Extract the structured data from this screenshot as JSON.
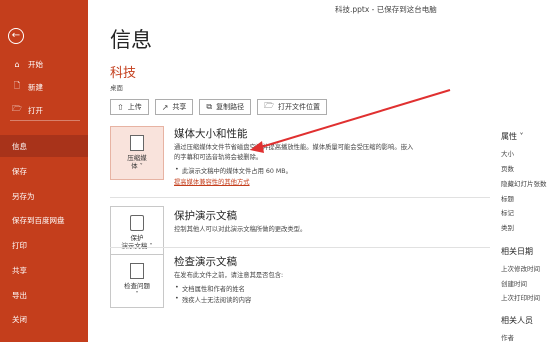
{
  "window": {
    "title": "科技.pptx - 已保存到这台电脑"
  },
  "sidebar": {
    "items": [
      {
        "label": "开始",
        "icon": "home-icon",
        "glyph": "⌂"
      },
      {
        "label": "新建",
        "icon": "new-file-icon",
        "glyph": "🗋"
      },
      {
        "label": "打开",
        "icon": "folder-open-icon",
        "glyph": "🗁"
      },
      {
        "label": "信息"
      },
      {
        "label": "保存"
      },
      {
        "label": "另存为"
      },
      {
        "label": "保存到百度网盘"
      },
      {
        "label": "打印"
      },
      {
        "label": "共享"
      },
      {
        "label": "导出"
      },
      {
        "label": "关闭"
      }
    ]
  },
  "main": {
    "title": "信息",
    "doc_name": "科技",
    "doc_location": "桌面",
    "toolbar": [
      {
        "label": "上传",
        "glyph": "⇧"
      },
      {
        "label": "共享",
        "glyph": "↗"
      },
      {
        "label": "复制路径",
        "glyph": "⧉"
      },
      {
        "label": "打开文件位置",
        "glyph": "🗁"
      }
    ],
    "sections": [
      {
        "button": "压缩媒\n体 ˅",
        "title": "媒体大小和性能",
        "desc1": "通过压缩媒体文件节省磁盘空间并提高播放性能。媒体质量可能会受压缩的影响。嵌入",
        "desc2": "的字幕和可选音轨将会被删除。",
        "bullet": "此演示文稿中的媒体文件占用 60 MB。",
        "link": "提高媒体兼容性的其他方式"
      },
      {
        "button": "保护\n演示文稿 ˅",
        "title": "保护演示文稿",
        "desc1": "控制其他人可以对此演示文稿所做的更改类型。"
      },
      {
        "button": "检查问题\n˅",
        "title": "检查演示文稿",
        "desc1": "在发布此文件之前，请注意其是否包含:",
        "bullet1": "文档属性和作者的姓名",
        "bullet2": "残疾人士无法阅读的内容"
      }
    ]
  },
  "properties": {
    "header": "属性 ˅",
    "items": [
      "大小",
      "页数",
      "隐藏幻灯片张数",
      "标题",
      "标记",
      "类别"
    ],
    "dates_header": "相关日期",
    "dates": [
      "上次修改时间",
      "创建时间",
      "上次打印时间"
    ],
    "people_header": "相关人员",
    "people": [
      "作者"
    ]
  },
  "colors": {
    "accent": "#c43e1c",
    "sidebar_active": "#a8331a",
    "arrow": "#e03030"
  }
}
